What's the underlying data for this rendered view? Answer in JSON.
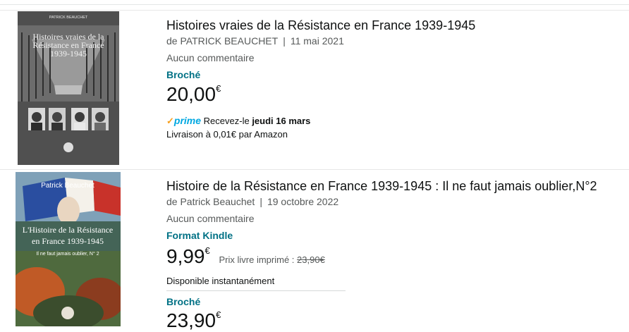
{
  "results": [
    {
      "title": "Histoires vraies de la Résistance en France 1939-1945",
      "author_prefix": "de",
      "author": "PATRICK BEAUCHET",
      "date": "11 mai 2021",
      "rating": "Aucun commentaire",
      "format": "Broché",
      "price_int": "20,00",
      "currency": "€",
      "prime_label": "prime",
      "delivery_prefix": "Recevez-le",
      "delivery_date": "jeudi 16 mars",
      "delivery_line2": "Livraison à 0,01€ par Amazon",
      "cover": {
        "author": "PATRICK BEAUCHET",
        "title_line1": "Histoires vraies de la",
        "title_line2": "Résistance en France",
        "title_line3": "1939-1945",
        "colors": {
          "bg": "#5b5b5b",
          "text": "#f2f2f2"
        }
      }
    },
    {
      "title": "Histoire de la Résistance en France 1939-1945 : Il ne faut jamais oublier,N°2",
      "author_prefix": "de",
      "author": "Patrick Beauchet",
      "date": "19 octobre 2022",
      "rating": "Aucun commentaire",
      "format": "Format Kindle",
      "price_int": "9,99",
      "currency": "€",
      "print_price_label": "Prix livre imprimé :",
      "print_price": "23,90€",
      "availability": "Disponible instantanément",
      "format2": "Broché",
      "price2_int": "23,90",
      "cover": {
        "author": "Patrick Beauchet",
        "title_line1": "L'Histoire de la Résistance",
        "title_line2": "en France 1939-1945",
        "title_line3": "Il ne faut jamais oublier, N° 2",
        "colors": {
          "bg": "#6a7b54",
          "text": "#ffffff"
        }
      }
    }
  ],
  "colors": {
    "link": "#007185",
    "prime": "#00a8e1",
    "check": "#f7a01e",
    "muted": "#565959"
  }
}
